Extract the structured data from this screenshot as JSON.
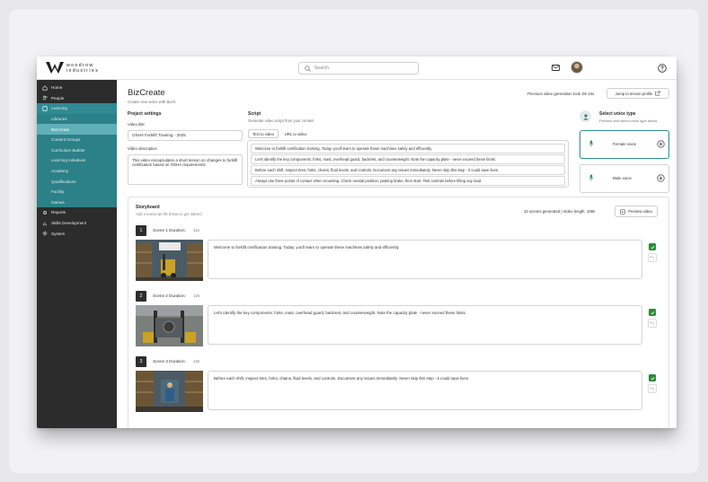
{
  "brand": {
    "name": "woodrow industries"
  },
  "topbar": {
    "search_placeholder": "Search"
  },
  "sidebar": {
    "items": [
      {
        "label": "Home",
        "icon": "home-icon"
      },
      {
        "label": "People",
        "icon": "people-icon"
      },
      {
        "label": "Learning",
        "icon": "book-icon"
      },
      {
        "label": "Libraries"
      },
      {
        "label": "BizCreate"
      },
      {
        "label": "Content Groups"
      },
      {
        "label": "Curriculum Builder"
      },
      {
        "label": "Learning Initiatives"
      },
      {
        "label": "Academy"
      },
      {
        "label": "Qualifications"
      },
      {
        "label": "Facility"
      },
      {
        "label": "Games"
      },
      {
        "label": "Reports",
        "icon": "gear-icon"
      },
      {
        "label": "Skills Development",
        "icon": "chart-icon"
      },
      {
        "label": "System",
        "icon": "settings-icon"
      }
    ]
  },
  "header": {
    "title": "BizCreate",
    "subtitle": "Create new video with BizAI",
    "generation_time": "Previous video generation took 3m 24s",
    "jump_label": "Jump to lesson profile"
  },
  "project": {
    "title": "Project settings",
    "video_title_label": "Video title",
    "video_title_value": "OSHA Forklift Training - 2025",
    "description_label": "Video description",
    "description_value": "This video encapsulates a short lesson on changes to forklift certification based on OSHA requirements"
  },
  "script": {
    "title": "Script",
    "subtitle": "Generate video script from your content",
    "tabs": [
      "Text to video",
      "URL to video"
    ],
    "lines": [
      "Welcome to forklift certification training. Today, you'll learn to operate these machines safely and efficiently.",
      "Let's identify the key components: forks, mast, overhead guard, backrest, and counterweight. Note the capacity plate - never exceed these limits.",
      "Before each shift, inspect tires, forks, chains, fluid levels, and controls. Document any issues immediately. Never skip this step - it could save lives.",
      "Always use three points of contact when mounting. Check neutral position, parking brake, then start. Test controls before lifting any load."
    ]
  },
  "voice": {
    "title": "Select voice type",
    "subtitle": "Preview and select voice type below",
    "options": [
      "Female voice",
      "Male voice"
    ],
    "selected": "Female voice"
  },
  "storyboard": {
    "title": "Storyboard",
    "subtitle": "Add a transcript file below to get started",
    "stats": "10 scenes generated | Video length: 108s",
    "preview_label": "Preview video",
    "scenes": [
      {
        "num": "1",
        "label": "Scene 1 Duration:",
        "duration": "11s",
        "text": "Welcome to forklift certification training. Today, you'll learn to operate these machines safely and efficiently."
      },
      {
        "num": "2",
        "label": "Scene 2 Duration:",
        "duration": "13s",
        "text": "Let's identify the key components: forks, mast, overhead guard, backrest, and counterweight. Note the capacity plate - never exceed these limits."
      },
      {
        "num": "3",
        "label": "Scene 3 Duration:",
        "duration": "13s",
        "text": "Before each shift, inspect tires, forks, chains, fluid levels, and controls. Document any issues immediately. Never skip this step - it could save lives."
      }
    ]
  },
  "colors": {
    "sidebar_bg": "#2c2c2c",
    "learning_accent": "#2f8a93",
    "selected_item": "#5fb0b8",
    "confirm_green": "#2f8a3a"
  }
}
